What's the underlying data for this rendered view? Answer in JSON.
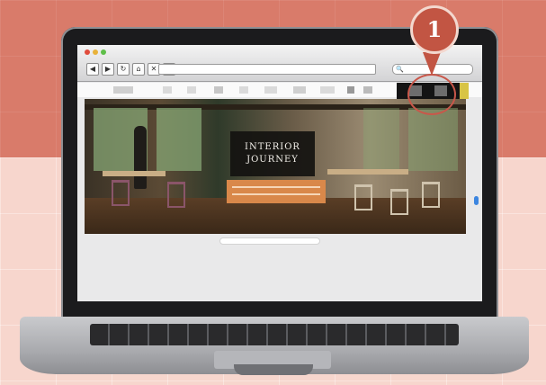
{
  "browser": {
    "nav_buttons": [
      "◀",
      "▶",
      "↻",
      "⌂",
      "✕",
      "+"
    ],
    "search_icon": "🔍"
  },
  "hero": {
    "title_line1": "INTERIOR",
    "title_line2": "JOURNEY"
  },
  "callout": {
    "number": "1"
  },
  "colors": {
    "background_top": "#d97b6a",
    "background_bottom": "#f7d6cd",
    "callout": "#c25543",
    "hero_button": "#d9884a"
  }
}
